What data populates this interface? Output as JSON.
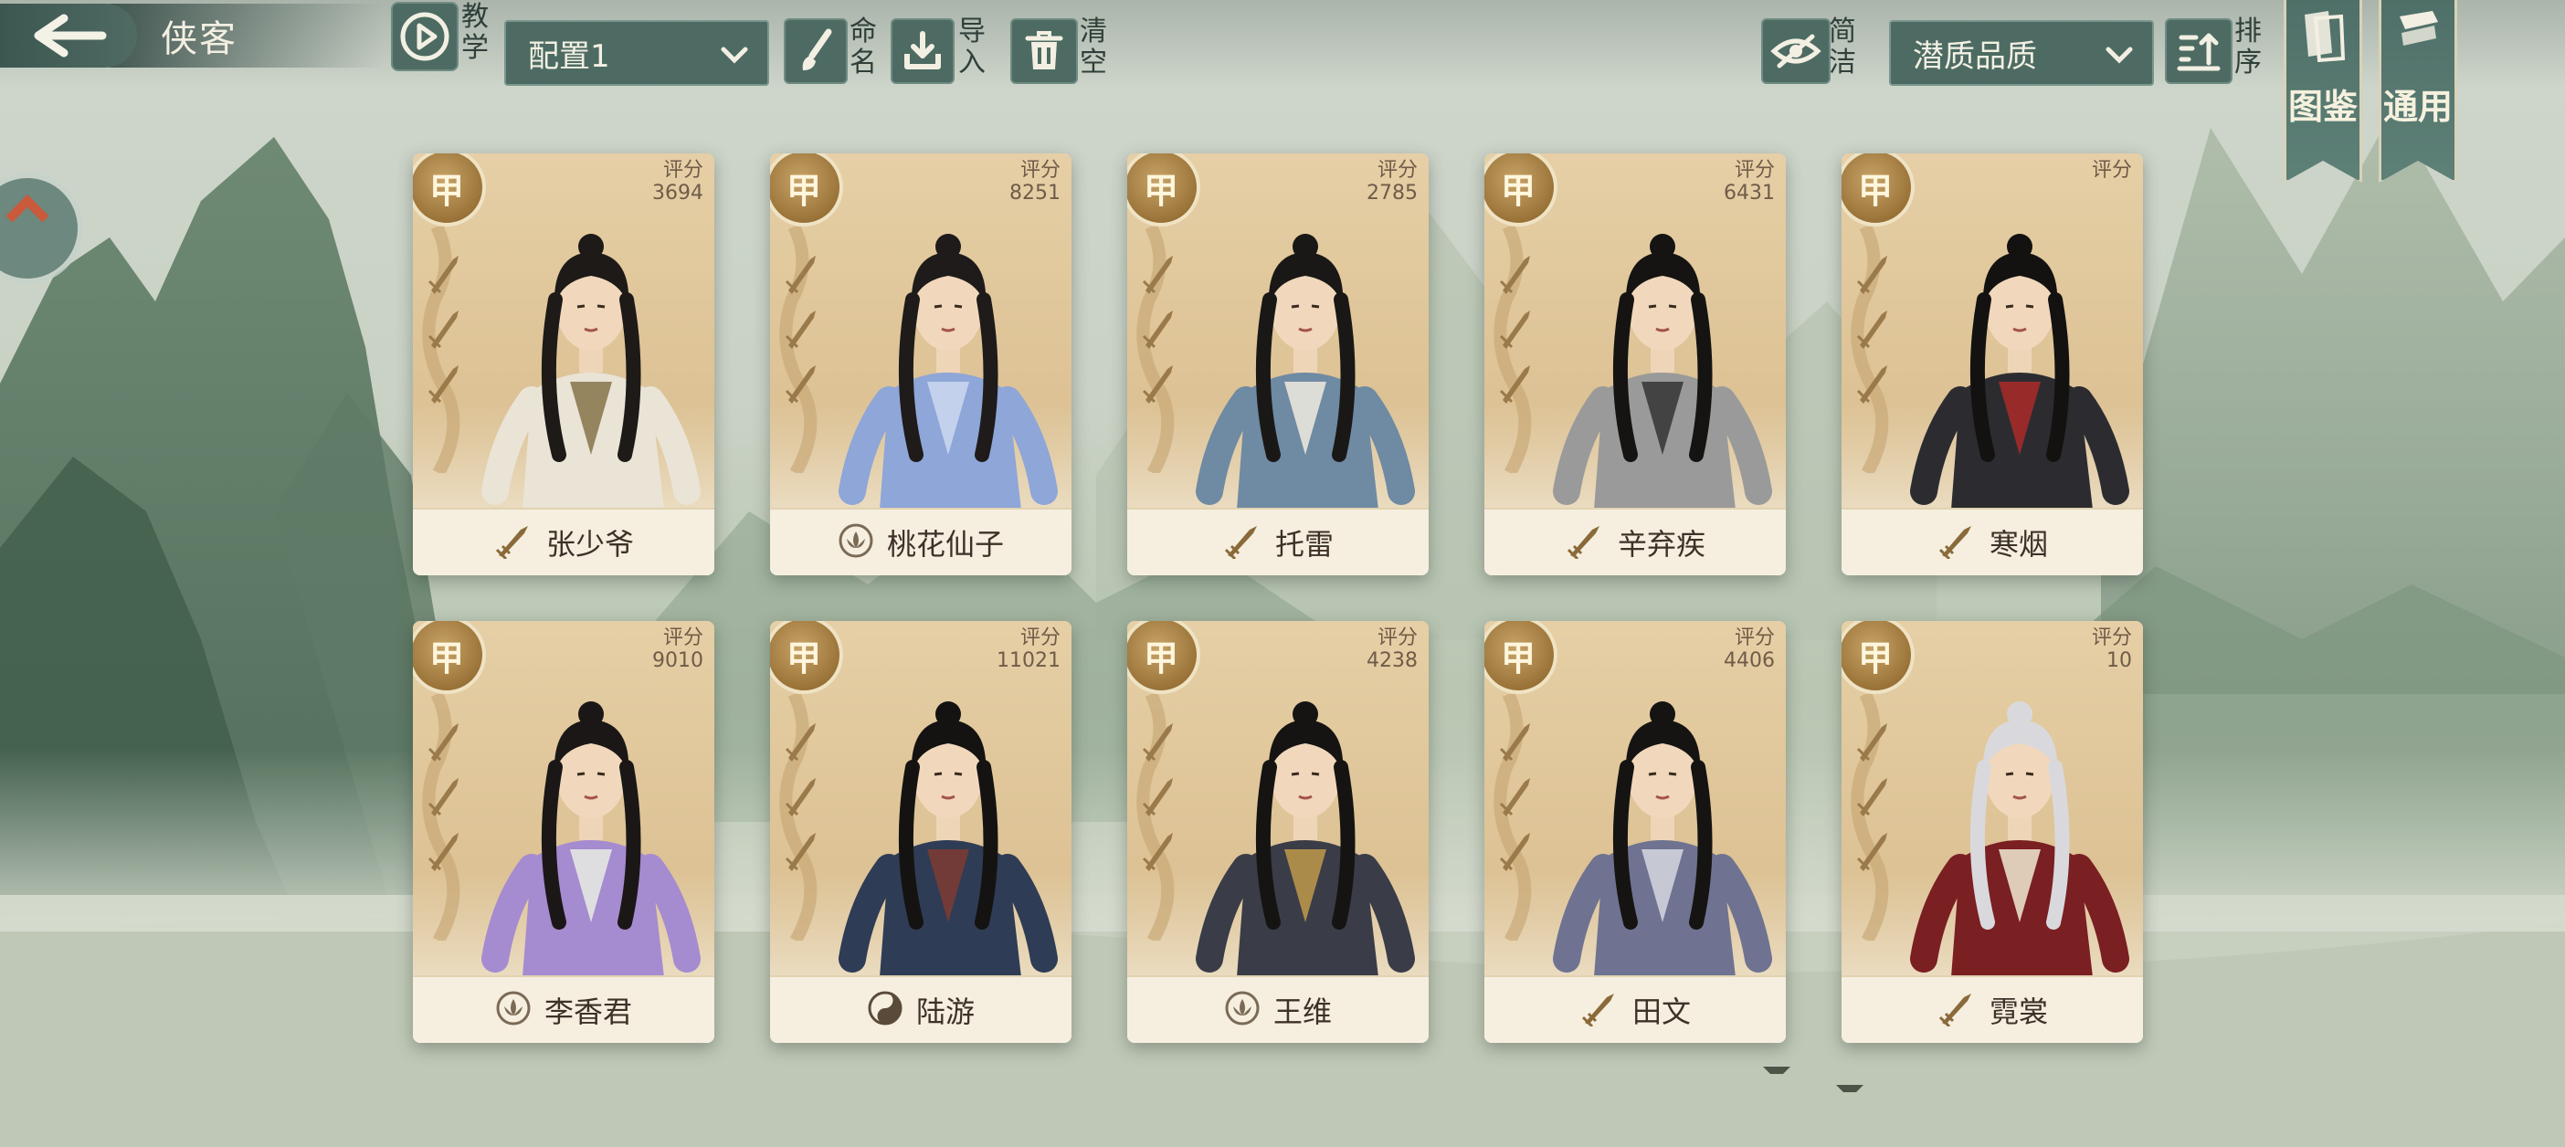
{
  "header": {
    "title": "侠客",
    "tutorial_label": "教学",
    "config_select": "配置1",
    "rename_label": "命名",
    "import_label": "导入",
    "clear_label": "清空",
    "simple_label": "简洁",
    "sort_select": "潜质品质",
    "sort_label": "排序",
    "atlas_label": "图鉴",
    "general_label": "通用"
  },
  "cards": [
    {
      "name": "张少爷",
      "grade": "甲",
      "score_label": "评分",
      "score": "3694",
      "school": "blade",
      "ranks": 3,
      "hair": "#1d1a18",
      "robe": "#e9e4d6",
      "accent": "#8c7a52"
    },
    {
      "name": "桃花仙子",
      "grade": "甲",
      "score_label": "评分",
      "score": "8251",
      "school": "lotus",
      "ranks": 3,
      "hair": "#1f1b1a",
      "robe": "#8ea6d8",
      "accent": "#c9d6ef"
    },
    {
      "name": "托雷",
      "grade": "甲",
      "score_label": "评分",
      "score": "2785",
      "school": "blade",
      "ranks": 3,
      "hair": "#1a1816",
      "robe": "#6f8aa3",
      "accent": "#e9e6dd"
    },
    {
      "name": "辛弃疾",
      "grade": "甲",
      "score_label": "评分",
      "score": "6431",
      "school": "blade",
      "ranks": 3,
      "hair": "#161412",
      "robe": "#9a9a9a",
      "accent": "#3a3a3a"
    },
    {
      "name": "寒烟",
      "grade": "甲",
      "score_label": "评分",
      "score": "",
      "school": "blade",
      "ranks": 3,
      "hair": "#141210",
      "robe": "#2c2c30",
      "accent": "#a42a2a"
    },
    {
      "name": "李香君",
      "grade": "甲",
      "score_label": "评分",
      "score": "9010",
      "school": "lotus",
      "ranks": 3,
      "hair": "#1b1716",
      "robe": "#a58bd0",
      "accent": "#e4e7e2"
    },
    {
      "name": "陆游",
      "grade": "甲",
      "score_label": "评分",
      "score": "11021",
      "school": "taiji",
      "ranks": 3,
      "hair": "#151311",
      "robe": "#2f3c55",
      "accent": "#7a3b34"
    },
    {
      "name": "王维",
      "grade": "甲",
      "score_label": "评分",
      "score": "4238",
      "school": "lotus",
      "ranks": 3,
      "hair": "#161412",
      "robe": "#3a3c48",
      "accent": "#b8934a"
    },
    {
      "name": "田文",
      "grade": "甲",
      "score_label": "评分",
      "score": "4406",
      "school": "blade",
      "ranks": 3,
      "hair": "#161412",
      "robe": "#6f7391",
      "accent": "#cfd2dc"
    },
    {
      "name": "霓裳",
      "grade": "甲",
      "score_label": "评分",
      "score": "10",
      "school": "blade",
      "ranks": 3,
      "hair": "#d9d9dd",
      "robe": "#7a1f22",
      "accent": "#e9dfc8"
    }
  ],
  "colors": {
    "ui_dark": "#4d6b62",
    "card_bg": "#f3ead8",
    "grade_gold": "#9a7338",
    "name_text": "#3d3128"
  }
}
